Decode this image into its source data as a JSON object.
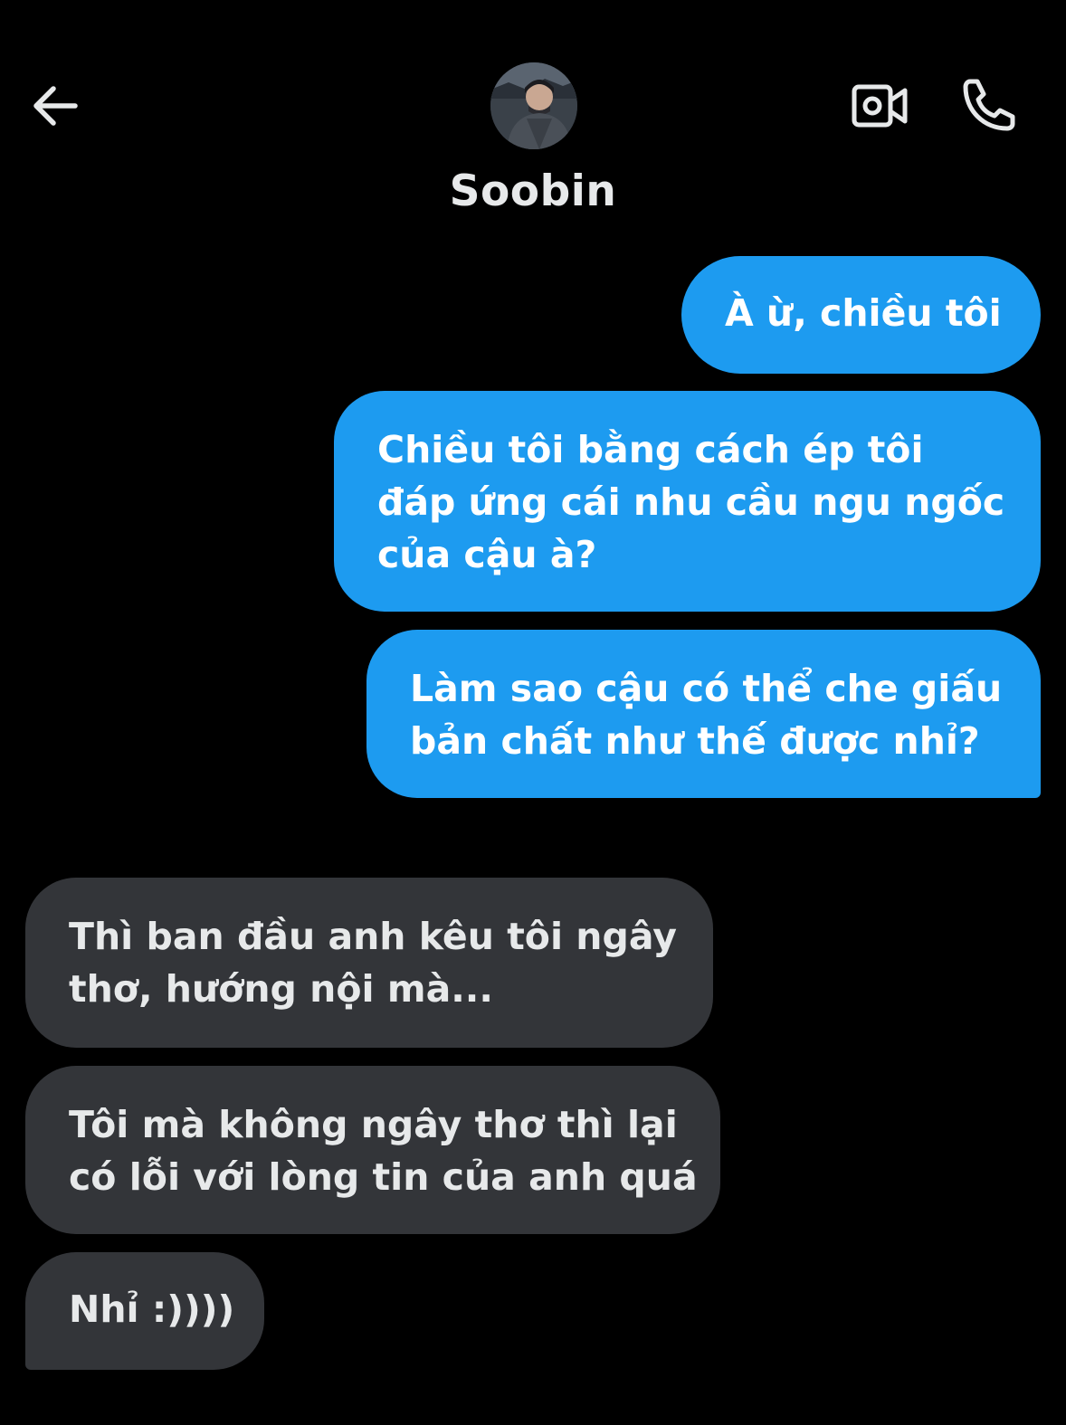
{
  "header": {
    "back_icon": "arrow-left-icon",
    "video_icon": "video-camera-icon",
    "call_icon": "phone-icon",
    "contact_name": "Soobin",
    "avatar": "contact-avatar-photo"
  },
  "colors": {
    "background": "#000000",
    "outgoing_bubble": "#1d9bf0",
    "incoming_bubble": "#333539",
    "text_light": "#e7e9ea"
  },
  "messages": [
    {
      "direction": "outgoing",
      "text": "À ừ, chiều tôi"
    },
    {
      "direction": "outgoing",
      "text": "Chiều tôi bằng cách ép tôi\nđáp ứng cái nhu cầu ngu ngốc\ncủa cậu à?"
    },
    {
      "direction": "outgoing",
      "text": "Làm sao cậu có thể che giấu\nbản chất như thế được nhỉ?"
    },
    {
      "direction": "incoming",
      "text": "Thì ban đầu anh kêu tôi ngây\nthơ, hướng nội mà..."
    },
    {
      "direction": "incoming",
      "text": "Tôi mà không ngây thơ thì lại\ncó lỗi với lòng tin của anh quá"
    },
    {
      "direction": "incoming",
      "text": "Nhỉ :))))"
    }
  ]
}
